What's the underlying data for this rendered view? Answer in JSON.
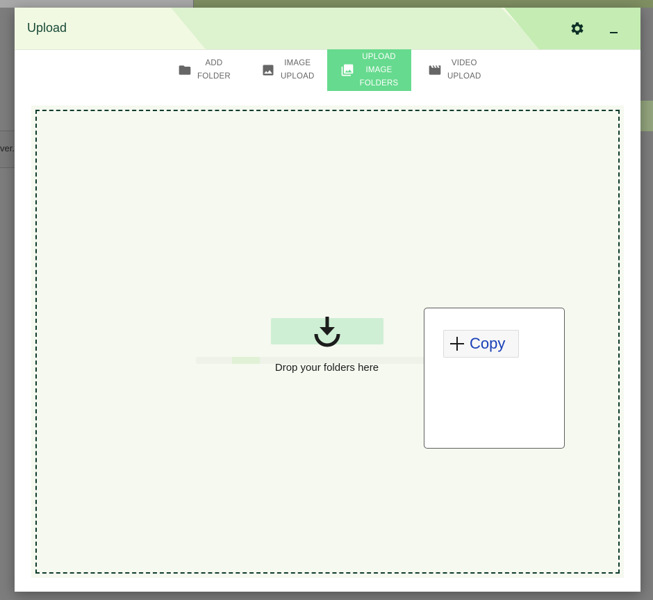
{
  "dialog": {
    "title": "Upload",
    "settings_icon": "gear-icon",
    "minimize_icon": "minimize-icon"
  },
  "background": {
    "truncated_text": "ver."
  },
  "tabs": [
    {
      "icon": "folder-icon",
      "line1": "ADD",
      "line2": "FOLDER",
      "line3": "",
      "active": false
    },
    {
      "icon": "image-icon",
      "line1": "IMAGE",
      "line2": "UPLOAD",
      "line3": "",
      "active": false
    },
    {
      "icon": "image-folders-icon",
      "line1": "UPLOAD",
      "line2": "IMAGE",
      "line3": "FOLDERS",
      "active": true
    },
    {
      "icon": "video-icon",
      "line1": "VIDEO",
      "line2": "UPLOAD",
      "line3": "",
      "active": false
    }
  ],
  "dropzone": {
    "label": "Drop your folders here",
    "icon": "download-icon"
  },
  "copy_popup": {
    "button_label": "Copy",
    "icon": "plus-icon"
  },
  "colors": {
    "accent": "#66da8e",
    "header_bg": "#f2f9e2",
    "header_wash": "#c8eeb8",
    "title_text": "#184b38",
    "dropzone_border": "#0f3b2e",
    "copy_label": "#1a40b8"
  }
}
